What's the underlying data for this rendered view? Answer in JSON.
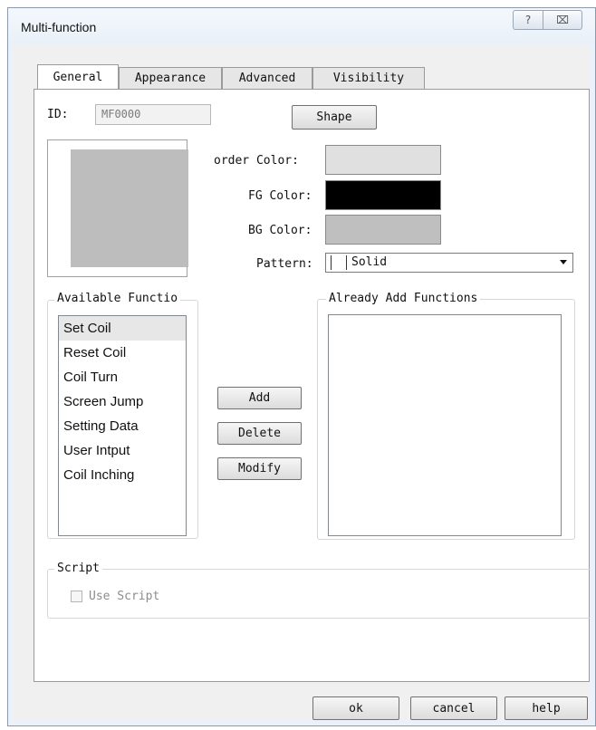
{
  "window": {
    "title": "Multi-function",
    "help_glyph": "?",
    "close_glyph": "⌧"
  },
  "tabs": [
    "General",
    "Appearance",
    "Advanced",
    "Visibility"
  ],
  "general": {
    "id_label": "ID:",
    "id_value": "MF0000",
    "shape_button": "Shape",
    "border_color_label": "order Color:",
    "fg_color_label": "FG Color:",
    "bg_color_label": "BG Color:",
    "pattern_label": "Pattern:",
    "pattern_value": "Solid",
    "colors": {
      "preview": "#bdbdbd",
      "border": "#e0e0e0",
      "fg": "#000000",
      "bg": "#bfbfbf"
    }
  },
  "available": {
    "title": "Available Functio",
    "items": [
      "Set Coil",
      "Reset Coil",
      "Coil Turn",
      "Screen Jump",
      "Setting Data",
      "User Intput",
      "Coil Inching"
    ],
    "selected_index": 0
  },
  "actions": {
    "add": "Add",
    "delete": "Delete",
    "modify": "Modify"
  },
  "already": {
    "title": "Already Add Functions",
    "items": []
  },
  "script": {
    "title": "Script",
    "use_script_label": "Use Script",
    "use_script_checked": false
  },
  "footer": {
    "ok": "ok",
    "cancel": "cancel",
    "help": "help"
  }
}
